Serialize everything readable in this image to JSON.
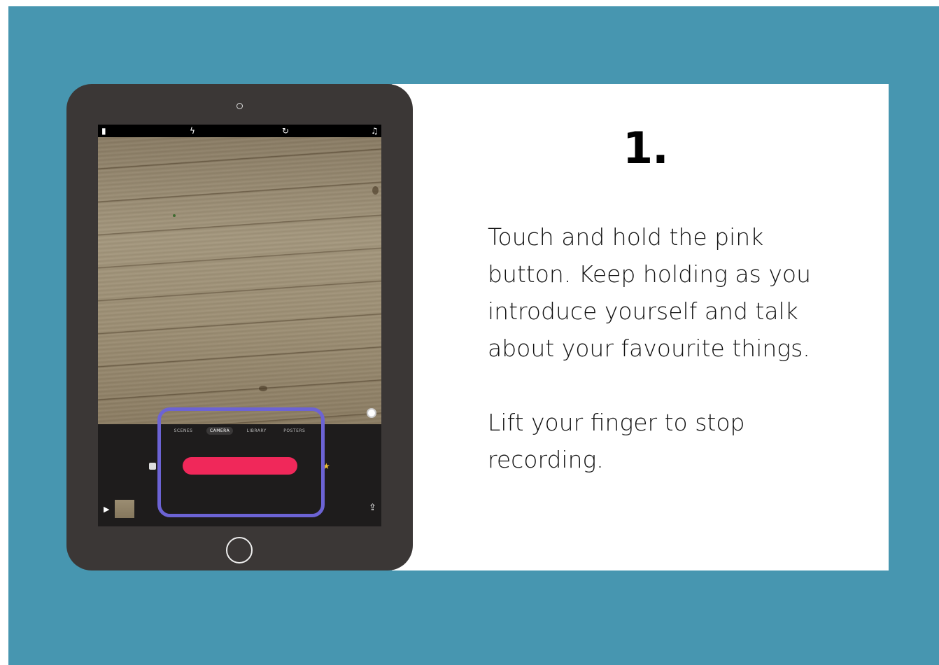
{
  "step": {
    "number": "1."
  },
  "instructions": {
    "paragraph_1": "Touch and hold the pink\nbutton.  Keep holding as you\nintroduce yourself and talk\nabout your favourite things.",
    "paragraph_2": "Lift your finger to stop\nrecording."
  },
  "app": {
    "modes": [
      "SCENES",
      "CAMERA",
      "LIBRARY",
      "POSTERS"
    ],
    "active_mode": "CAMERA",
    "statusbar_icons": [
      "clip-icon",
      "flash-icon",
      "flip-camera-icon",
      "music-icon"
    ]
  },
  "colors": {
    "background": "#4796b0",
    "record_button": "#f0285a",
    "highlight": "#6c63d4"
  }
}
